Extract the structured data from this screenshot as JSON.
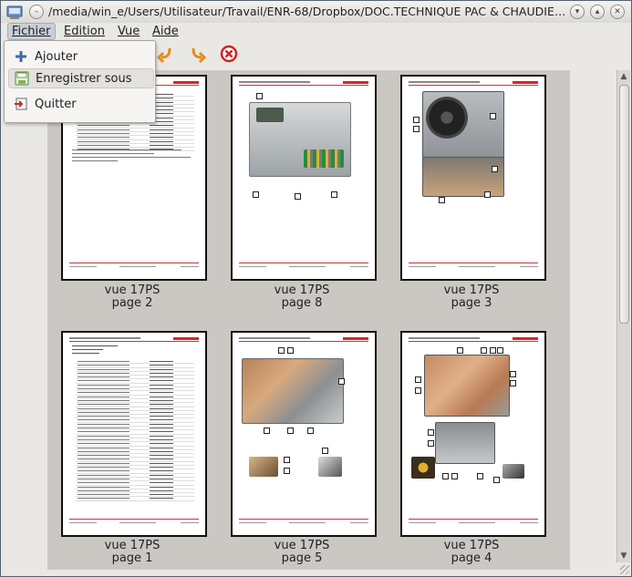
{
  "window": {
    "title": "/media/win_e/Users/Utilisateur/Travail/ENR-68/Dropbox/DOC.TECHNIQUE PAC & CHAUDIERES/Dim..."
  },
  "menubar": {
    "items": [
      {
        "label": "Fichier"
      },
      {
        "label": "Edition"
      },
      {
        "label": "Vue"
      },
      {
        "label": "Aide"
      }
    ]
  },
  "file_menu": {
    "items": [
      {
        "label": "Ajouter",
        "icon": "plus-icon"
      },
      {
        "label": "Enregistrer sous",
        "icon": "save-as-icon",
        "highlighted": true
      },
      {
        "label": "Quitter",
        "icon": "quit-icon"
      }
    ]
  },
  "toolbar": {
    "icons": [
      "rotate-left-icon",
      "rotate-right-icon",
      "remove-icon"
    ]
  },
  "pages": [
    {
      "name": "vue 17PS",
      "page": "page 2",
      "kind": "table"
    },
    {
      "name": "vue 17PS",
      "page": "page 8",
      "kind": "board"
    },
    {
      "name": "vue 17PS",
      "page": "page 3",
      "kind": "unit"
    },
    {
      "name": "vue 17PS",
      "page": "page 1",
      "kind": "list"
    },
    {
      "name": "vue 17PS",
      "page": "page 5",
      "kind": "photos"
    },
    {
      "name": "vue 17PS",
      "page": "page 4",
      "kind": "photos2"
    }
  ],
  "colors": {
    "accent_red": "#d22222",
    "highlight": "#e3e1de",
    "window_bg": "#e9e8e5",
    "viewer_bg": "#cbc7c2"
  }
}
